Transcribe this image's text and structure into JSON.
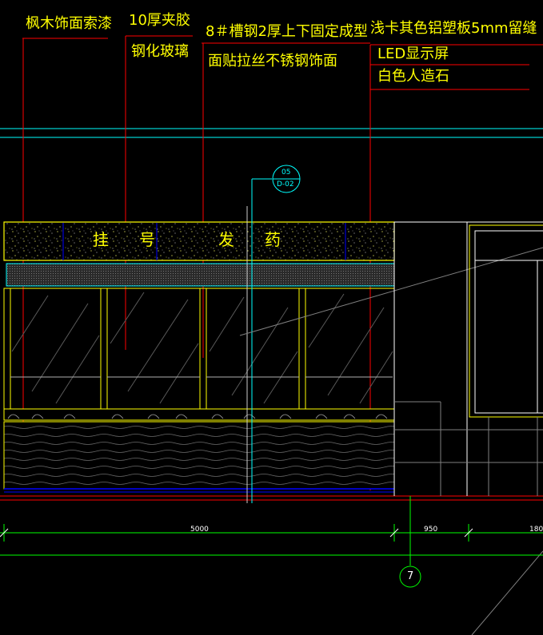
{
  "annotations": {
    "maple_veneer": "枫木饰面索漆",
    "laminated_glass_1": "10厚夹胶",
    "laminated_glass_2": "钢化玻璃",
    "channel_steel": "8＃槽钢2厚上下固定成型",
    "aluminum_plastic": "浅卡其色铝塑板5mm留缝",
    "stainless": "面贴拉丝不锈钢饰面",
    "led": "LED显示屏",
    "stone": "白色人造石"
  },
  "section_tag": {
    "top": "05",
    "bottom": "D-02"
  },
  "sign_chars": [
    "挂",
    "号",
    "发",
    "药"
  ],
  "dimensions": {
    "d1": "5000",
    "d2": "950",
    "d3": "180"
  },
  "axis_grid": "7",
  "colors": {
    "background": "#000000",
    "yellow": "#ffff00",
    "cyan": "#00ffff",
    "red": "#ff0000",
    "green": "#00ff00",
    "white": "#ffffff",
    "blue": "#0000ff",
    "gray": "#808080"
  }
}
